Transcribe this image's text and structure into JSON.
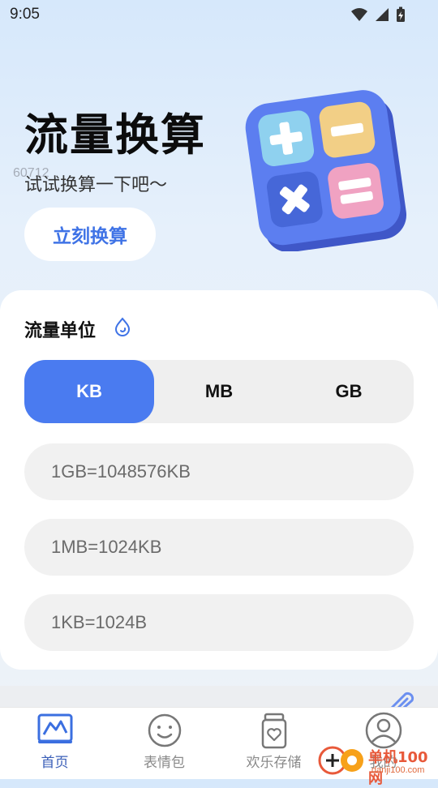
{
  "status_bar": {
    "time": "9:05"
  },
  "hero": {
    "title": "流量换算",
    "watermark_number": "60712",
    "subtitle": "试试换算一下吧～",
    "button_label": "立刻换算"
  },
  "converter": {
    "section_title": "流量单位",
    "units": [
      "KB",
      "MB",
      "GB"
    ],
    "selected_unit": "KB",
    "results": [
      "1GB=1048576KB",
      "1MB=1024KB",
      "1KB=1024B"
    ]
  },
  "tabbar": {
    "items": [
      {
        "label": "首页",
        "icon": "chart-icon",
        "active": true
      },
      {
        "label": "表情包",
        "icon": "smiley-icon",
        "active": false
      },
      {
        "label": "欢乐存储",
        "icon": "storage-jar-icon",
        "active": false
      },
      {
        "label": "我的",
        "icon": "profile-icon",
        "active": false
      }
    ]
  },
  "watermark": {
    "text": "单机100网",
    "url": "danji100.com"
  },
  "colors": {
    "accent": "#4a7bf0",
    "button_text": "#3f73e6"
  }
}
